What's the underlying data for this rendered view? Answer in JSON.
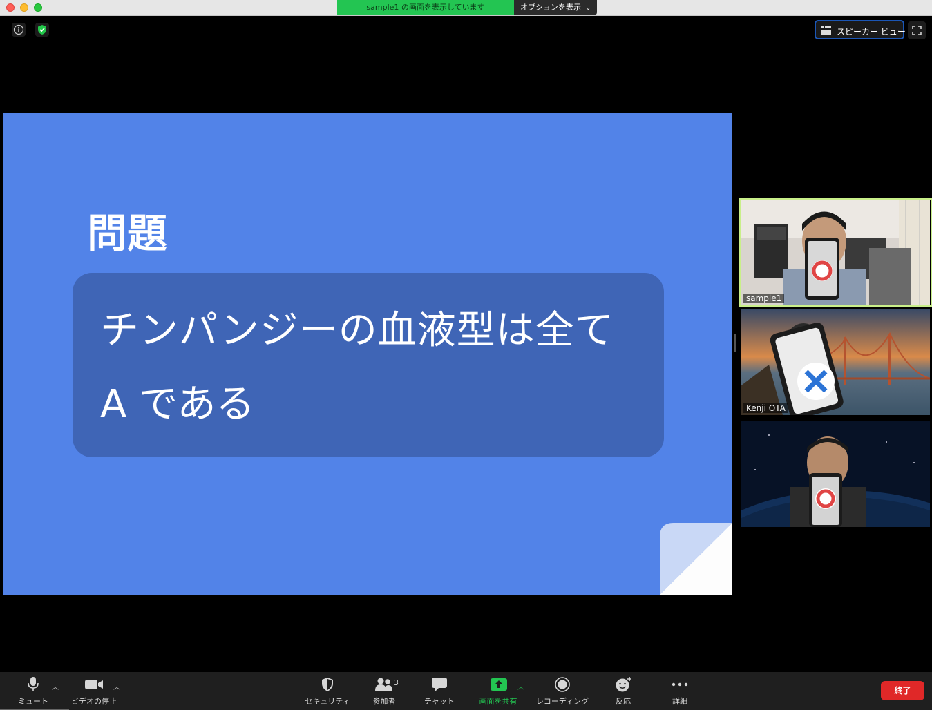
{
  "titlebar": {
    "share_status": "sample1 の画面を表示しています",
    "options_label": "オプションを表示"
  },
  "top_controls": {
    "view_label": "スピーカー ビュー"
  },
  "slide": {
    "heading": "問題",
    "line1": "チンパンジーの血液型は全て",
    "line2": "A である"
  },
  "participants": [
    {
      "name": "sample1",
      "active_speaker": true
    },
    {
      "name": "Kenji OTA",
      "active_speaker": false
    },
    {
      "name": "",
      "active_speaker": false
    }
  ],
  "toolbar": {
    "mute_label": "ミュート",
    "video_label": "ビデオの停止",
    "security_label": "セキュリティ",
    "participants_label": "参加者",
    "participants_count": "3",
    "chat_label": "チャット",
    "share_label": "画面を共有",
    "record_label": "レコーディング",
    "reactions_label": "反応",
    "more_label": "詳細",
    "end_label": "終了"
  },
  "colors": {
    "share_green": "#23c552",
    "slide_blue": "#5283e8",
    "slide_box": "#3f65b6",
    "active_border": "#c9ef8a",
    "end_red": "#e02828"
  }
}
